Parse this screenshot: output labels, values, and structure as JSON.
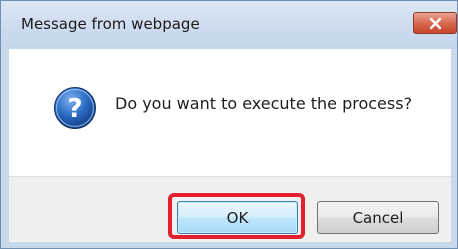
{
  "dialog": {
    "title": "Message from webpage",
    "message": "Do you want to execute the process?",
    "icon": "question-icon",
    "close_icon": "close-icon",
    "buttons": {
      "ok_label": "OK",
      "cancel_label": "Cancel"
    },
    "colors": {
      "titlebar": "#c9d9ec",
      "close_button": "#c8452a",
      "highlight": "#e5202e",
      "icon_blue": "#1f5fae"
    }
  }
}
